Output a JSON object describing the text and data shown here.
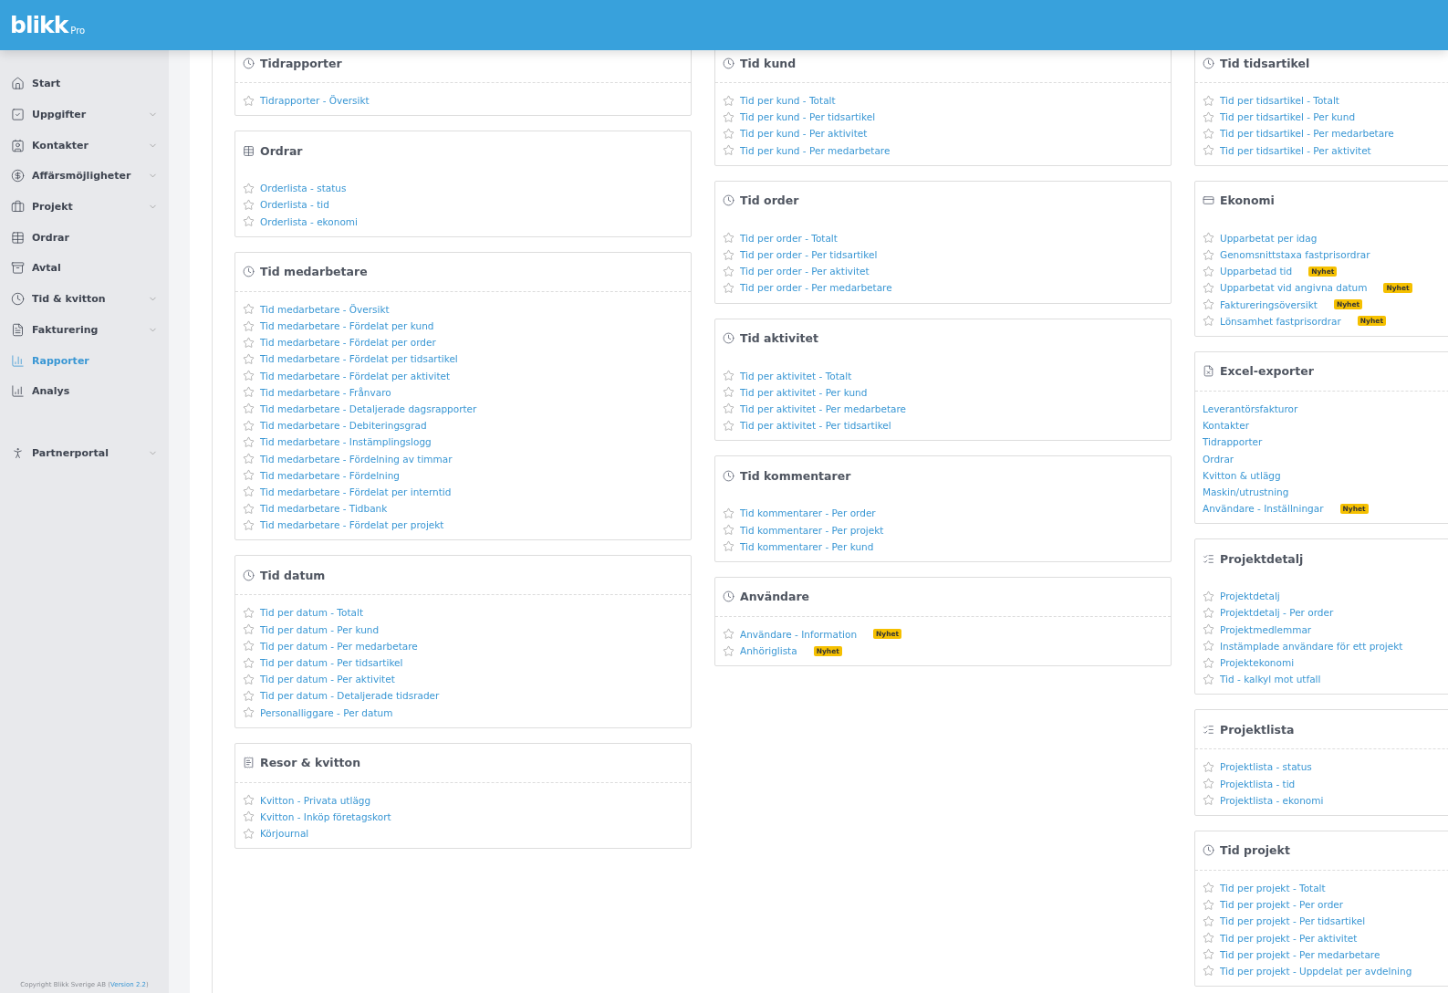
{
  "header": {
    "logo": "blikk",
    "edition": "Pro"
  },
  "sidebar": {
    "items": [
      {
        "label": "Start",
        "expandable": false,
        "selected": false
      },
      {
        "label": "Uppgifter",
        "expandable": true,
        "selected": false
      },
      {
        "label": "Kontakter",
        "expandable": true,
        "selected": false
      },
      {
        "label": "Affärsmöjligheter",
        "expandable": true,
        "selected": false
      },
      {
        "label": "Projekt",
        "expandable": true,
        "selected": false
      },
      {
        "label": "Ordrar",
        "expandable": false,
        "selected": false
      },
      {
        "label": "Avtal",
        "expandable": false,
        "selected": false
      },
      {
        "label": "Tid & kvitton",
        "expandable": true,
        "selected": false
      },
      {
        "label": "Fakturering",
        "expandable": true,
        "selected": false
      },
      {
        "label": "Rapporter",
        "expandable": false,
        "selected": true
      },
      {
        "label": "Analys",
        "expandable": false,
        "selected": false
      }
    ],
    "secondary_items": [
      {
        "label": "Partnerportal",
        "expandable": true,
        "selected": false
      }
    ],
    "footer": {
      "prefix": "Copyright Blikk Sverige AB (",
      "version": "Version 2.2",
      "suffix": ")"
    }
  },
  "columns": [
    [
      {
        "title": "Tidrapporter",
        "divider": true,
        "kind": "reports",
        "items": [
          {
            "label": "Tidrapporter - Översikt"
          }
        ]
      },
      {
        "title": "Ordrar",
        "divider": false,
        "kind": "reports",
        "items": [
          {
            "label": "Orderlista - status"
          },
          {
            "label": "Orderlista - tid"
          },
          {
            "label": "Orderlista - ekonomi"
          }
        ]
      },
      {
        "title": "Tid medarbetare",
        "divider": true,
        "kind": "reports",
        "items": [
          {
            "label": "Tid medarbetare - Översikt"
          },
          {
            "label": "Tid medarbetare - Fördelat per kund"
          },
          {
            "label": "Tid medarbetare - Fördelat per order"
          },
          {
            "label": "Tid medarbetare - Fördelat per tidsartikel"
          },
          {
            "label": "Tid medarbetare - Fördelat per aktivitet"
          },
          {
            "label": "Tid medarbetare - Frånvaro"
          },
          {
            "label": "Tid medarbetare - Detaljerade dagsrapporter"
          },
          {
            "label": "Tid medarbetare - Debiteringsgrad"
          },
          {
            "label": "Tid medarbetare - Instämplingslogg"
          },
          {
            "label": "Tid medarbetare - Fördelning av timmar"
          },
          {
            "label": "Tid medarbetare - Fördelning"
          },
          {
            "label": "Tid medarbetare - Fördelat per interntid"
          },
          {
            "label": "Tid medarbetare - Tidbank"
          },
          {
            "label": "Tid medarbetare - Fördelat per projekt"
          }
        ]
      },
      {
        "title": "Tid datum",
        "divider": true,
        "kind": "reports",
        "items": [
          {
            "label": "Tid per datum - Totalt"
          },
          {
            "label": "Tid per datum - Per kund"
          },
          {
            "label": "Tid per datum - Per medarbetare"
          },
          {
            "label": "Tid per datum - Per tidsartikel"
          },
          {
            "label": "Tid per datum - Per aktivitet"
          },
          {
            "label": "Tid per datum - Detaljerade tidsrader"
          },
          {
            "label": "Personalliggare - Per datum"
          }
        ]
      },
      {
        "title": "Resor & kvitton",
        "divider": true,
        "kind": "reports",
        "items": [
          {
            "label": "Kvitton - Privata utlägg"
          },
          {
            "label": "Kvitton - Inköp företagskort"
          },
          {
            "label": "Körjournal"
          }
        ]
      }
    ],
    [
      {
        "title": "Tid kund",
        "divider": true,
        "kind": "reports",
        "items": [
          {
            "label": "Tid per kund - Totalt"
          },
          {
            "label": "Tid per kund - Per tidsartikel"
          },
          {
            "label": "Tid per kund - Per aktivitet"
          },
          {
            "label": "Tid per kund - Per medarbetare"
          }
        ]
      },
      {
        "title": "Tid order",
        "divider": false,
        "kind": "reports",
        "items": [
          {
            "label": "Tid per order - Totalt"
          },
          {
            "label": "Tid per order - Per tidsartikel"
          },
          {
            "label": "Tid per order - Per aktivitet"
          },
          {
            "label": "Tid per order - Per medarbetare"
          }
        ]
      },
      {
        "title": "Tid aktivitet",
        "divider": false,
        "kind": "reports",
        "items": [
          {
            "label": "Tid per aktivitet - Totalt"
          },
          {
            "label": "Tid per aktivitet - Per kund"
          },
          {
            "label": "Tid per aktivitet - Per medarbetare"
          },
          {
            "label": "Tid per aktivitet - Per tidsartikel"
          }
        ]
      },
      {
        "title": "Tid kommentarer",
        "divider": false,
        "kind": "reports",
        "items": [
          {
            "label": "Tid kommentarer - Per order"
          },
          {
            "label": "Tid kommentarer - Per projekt"
          },
          {
            "label": "Tid kommentarer - Per kund"
          }
        ]
      },
      {
        "title": "Användare",
        "divider": true,
        "kind": "reports",
        "items": [
          {
            "label": "Användare - Information",
            "badge": "Nyhet"
          },
          {
            "label": "Anhöriglista",
            "badge": "Nyhet"
          }
        ]
      }
    ],
    [
      {
        "title": "Tid tidsartikel",
        "divider": true,
        "kind": "reports",
        "items": [
          {
            "label": "Tid per tidsartikel - Totalt"
          },
          {
            "label": "Tid per tidsartikel - Per kund"
          },
          {
            "label": "Tid per tidsartikel - Per medarbetare"
          },
          {
            "label": "Tid per tidsartikel - Per aktivitet"
          }
        ]
      },
      {
        "title": "Ekonomi",
        "divider": false,
        "kind": "reports",
        "items": [
          {
            "label": "Upparbetat per idag"
          },
          {
            "label": "Genomsnittstaxa fastprisordrar"
          },
          {
            "label": "Upparbetad tid",
            "badge": "Nyhet"
          },
          {
            "label": "Upparbetat vid angivna datum",
            "badge": "Nyhet"
          },
          {
            "label": "Faktureringsöversikt",
            "badge": "Nyhet"
          },
          {
            "label": "Lönsamhet fastprisordrar",
            "badge": "Nyhet"
          }
        ]
      },
      {
        "title": "Excel-exporter",
        "divider": true,
        "kind": "exports",
        "items": [
          {
            "label": "Leverantörsfakturor"
          },
          {
            "label": "Kontakter"
          },
          {
            "label": "Tidrapporter"
          },
          {
            "label": "Ordrar"
          },
          {
            "label": "Kvitton & utlägg"
          },
          {
            "label": "Maskin/utrustning"
          },
          {
            "label": "Användare - Inställningar",
            "badge": "Nyhet"
          }
        ]
      },
      {
        "title": "Projektdetalj",
        "divider": false,
        "kind": "reports",
        "items": [
          {
            "label": "Projektdetalj"
          },
          {
            "label": "Projektdetalj - Per order"
          },
          {
            "label": "Projektmedlemmar"
          },
          {
            "label": "Instämplade användare för ett projekt"
          },
          {
            "label": "Projektekonomi"
          },
          {
            "label": "Tid - kalkyl mot utfall"
          }
        ]
      },
      {
        "title": "Projektlista",
        "divider": true,
        "kind": "reports",
        "items": [
          {
            "label": "Projektlista - status"
          },
          {
            "label": "Projektlista - tid"
          },
          {
            "label": "Projektlista - ekonomi"
          }
        ]
      },
      {
        "title": "Tid projekt",
        "divider": true,
        "kind": "reports",
        "items": [
          {
            "label": "Tid per projekt - Totalt"
          },
          {
            "label": "Tid per projekt - Per order"
          },
          {
            "label": "Tid per projekt - Per tidsartikel"
          },
          {
            "label": "Tid per projekt - Per aktivitet"
          },
          {
            "label": "Tid per projekt - Per medarbetare"
          },
          {
            "label": "Tid per projekt - Uppdelat per avdelning"
          }
        ]
      }
    ]
  ]
}
